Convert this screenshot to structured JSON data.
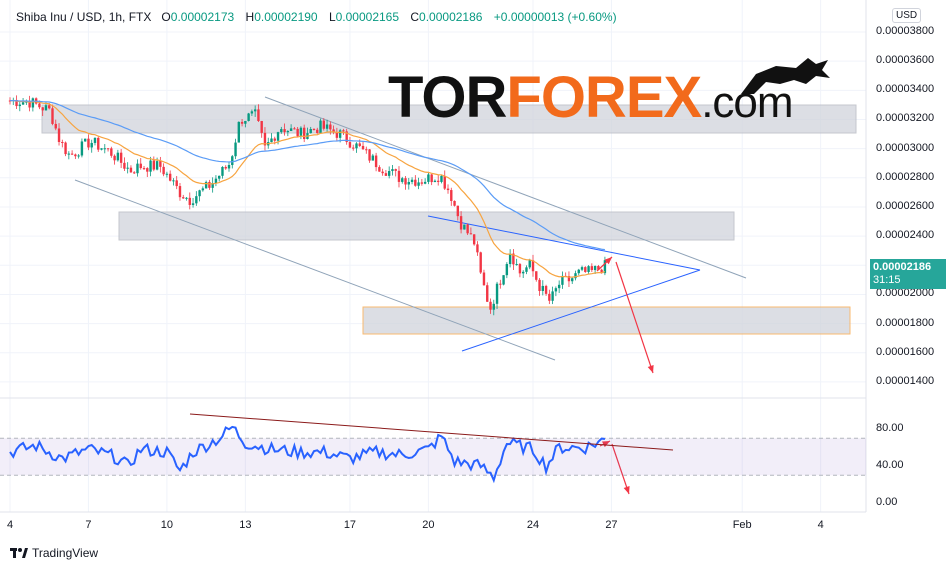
{
  "legend": {
    "symbol": "Shiba Inu / USD, 1h, FTX",
    "o_label": "O",
    "o": "0.00002173",
    "h_label": "H",
    "h": "0.00002190",
    "l_label": "L",
    "l": "0.00002165",
    "c_label": "C",
    "c": "0.00002186",
    "change": "+0.00000013 (+0.60%)"
  },
  "currency": "USD",
  "last_price": "0.00002186",
  "countdown": "31:15",
  "logo": {
    "part1": "TOR",
    "part2": "FOREX",
    "part3": ".com"
  },
  "brand": "TradingView",
  "colors": {
    "up": "#089981",
    "down": "#f23645",
    "ema_fast": "#f7a440",
    "ema_slow": "#5b9cf6",
    "rsi": "#2962ff",
    "arrow": "#f23645"
  },
  "chart_data": [
    {
      "type": "candlestick",
      "title": "Shiba Inu / USD, 1h, FTX",
      "ylim": [
        1.3e-05,
        3.85e-05
      ],
      "y_ticks": [
        "0.00003800",
        "0.00003600",
        "0.00003400",
        "0.00003200",
        "0.00003000",
        "0.00002800",
        "0.00002600",
        "0.00002400",
        "0.00002000",
        "0.00001800",
        "0.00001600",
        "0.00001400"
      ],
      "x_ticks": [
        {
          "label": "4",
          "day": 4
        },
        {
          "label": "7",
          "day": 7
        },
        {
          "label": "10",
          "day": 10
        },
        {
          "label": "13",
          "day": 13
        },
        {
          "label": "17",
          "day": 17
        },
        {
          "label": "20",
          "day": 20
        },
        {
          "label": "24",
          "day": 24
        },
        {
          "label": "27",
          "day": 27
        },
        {
          "label": "Feb",
          "day": 32
        },
        {
          "label": "4",
          "day": 35
        }
      ],
      "price_keypoints_day": [
        4.0,
        4.76,
        5.53,
        5.91,
        6.29,
        7.06,
        7.82,
        8.59,
        8.97,
        9.74,
        10.5,
        10.88,
        11.65,
        12.41,
        12.8,
        13.37,
        13.75,
        14.33,
        15.09,
        15.85,
        16.62,
        17.38,
        18.15,
        18.91,
        19.68,
        20.44,
        20.83,
        21.21,
        21.78,
        21.97,
        22.36,
        22.74,
        23.12,
        23.5,
        23.89,
        24.27,
        24.65,
        25.03,
        25.41,
        25.8,
        26.18,
        26.56,
        26.87
      ],
      "price_keypoints_e6": [
        33.3,
        33.2,
        32.6,
        30.5,
        29.5,
        30.5,
        29.8,
        28.5,
        28.8,
        28.8,
        27.0,
        26.5,
        27.5,
        29.0,
        32.0,
        32.3,
        30.0,
        31.5,
        31.0,
        31.5,
        31.0,
        30.0,
        28.8,
        28.0,
        27.8,
        28.2,
        27.0,
        25.0,
        23.5,
        21.5,
        19.0,
        21.0,
        23.0,
        21.5,
        22.0,
        20.5,
        19.5,
        20.8,
        21.0,
        21.5,
        21.5,
        21.8,
        22.0
      ]
    },
    {
      "type": "line",
      "title": "RSI",
      "ylim": [
        0,
        100
      ],
      "y_ticks": [
        "80.00",
        "40.00",
        "0.00"
      ],
      "bands": [
        30,
        70
      ],
      "rsi_day": [
        4,
        5,
        6,
        7,
        8,
        8.5,
        9,
        10,
        10.5,
        11,
        12,
        12.5,
        13,
        14,
        15,
        16,
        17,
        18,
        19,
        20,
        20.5,
        21,
        22,
        22.5,
        23,
        24,
        24.5,
        25,
        26,
        26.87
      ],
      "rsi_values": [
        55,
        62,
        48,
        58,
        50,
        40,
        58,
        55,
        35,
        55,
        70,
        82,
        65,
        58,
        55,
        55,
        48,
        55,
        52,
        58,
        72,
        45,
        40,
        28,
        65,
        58,
        40,
        60,
        60,
        70
      ]
    }
  ]
}
